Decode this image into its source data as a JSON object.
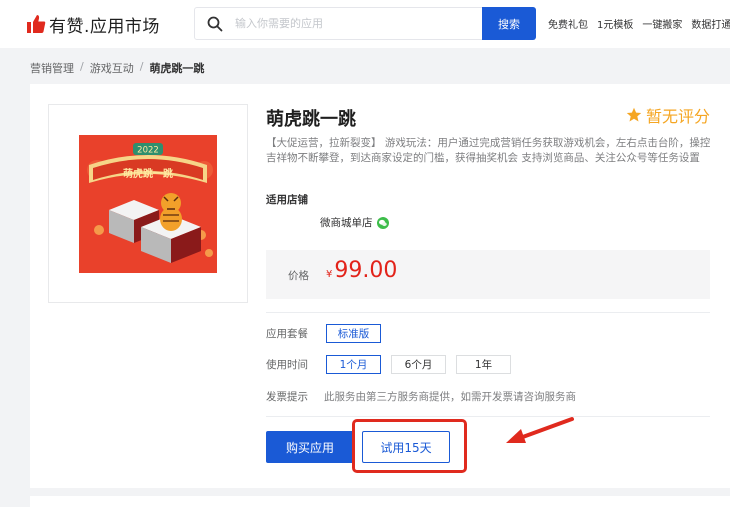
{
  "header": {
    "brand": "有赞.应用市场",
    "search_placeholder": "输入你需要的应用",
    "search_button": "搜索",
    "top_links": [
      "免费礼包",
      "1元模板",
      "一键搬家",
      "数据打通"
    ]
  },
  "breadcrumb": {
    "items": [
      "营销管理",
      "游戏互动"
    ],
    "current": "萌虎跳一跳"
  },
  "product": {
    "title": "萌虎跳一跳",
    "rating_text": "暂无评分",
    "description": "【大促运营，拉新裂变】 游戏玩法：用户通过完成营销任务获取游戏机会，左右点击台阶，操控吉祥物不断攀登，到达商家设定的门槛，获得抽奖机会 支持浏览商品、关注公众号等任务设置",
    "shop_label": "适用店铺",
    "shop_name": "微商城单店",
    "price_label": "价格",
    "currency": "¥",
    "price": "99.00",
    "thumbnail": {
      "badge_year": "2022",
      "banner_text": "萌虎跳一跳"
    }
  },
  "options": {
    "package_label": "应用套餐",
    "package_value": "标准版",
    "duration_label": "使用时间",
    "durations": [
      "1个月",
      "6个月",
      "1年"
    ],
    "selected_duration": 0,
    "invoice_label": "发票提示",
    "invoice_text": "此服务由第三方服务商提供，如需开发票请咨询服务商"
  },
  "actions": {
    "buy_label": "购买应用",
    "trial_label": "试用15天"
  },
  "colors": {
    "primary": "#1a5ad6",
    "price_red": "#e2231a",
    "rating_orange": "#f5a623",
    "annotation_red": "#e02a1e"
  },
  "icons": {
    "logo": "thumbs-up-icon",
    "search": "search-icon",
    "rating": "star-icon",
    "shop": "wechat-icon"
  }
}
